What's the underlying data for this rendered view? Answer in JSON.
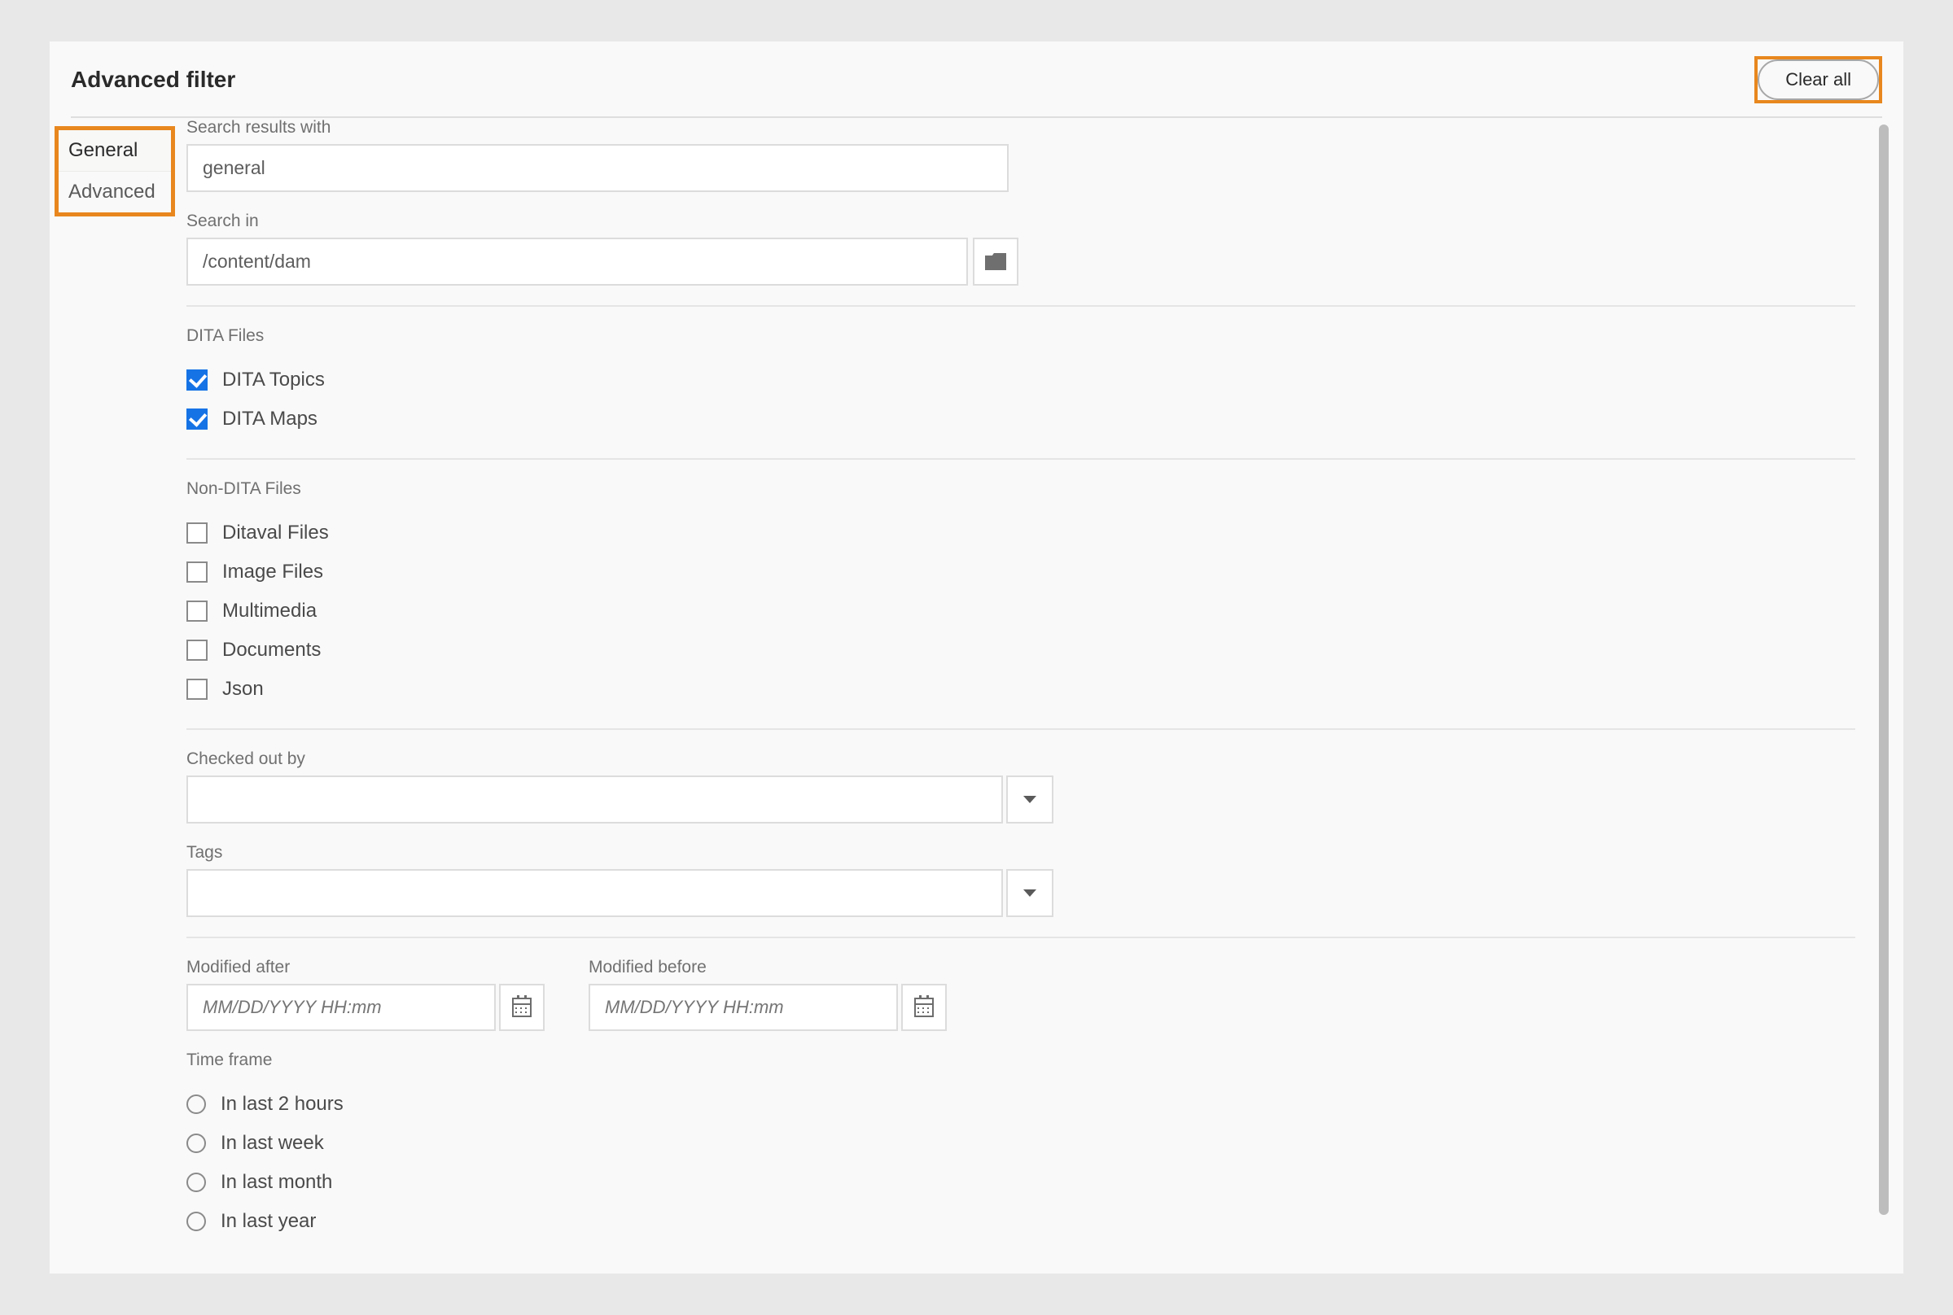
{
  "title": "Advanced filter",
  "clear_all": "Clear all",
  "tabs": {
    "general": "General",
    "advanced": "Advanced"
  },
  "search_results_with": {
    "label": "Search results with",
    "value": "general"
  },
  "search_in": {
    "label": "Search in",
    "value": "/content/dam"
  },
  "sections": {
    "dita_files": {
      "head": "DITA Files",
      "topics": {
        "label": "DITA Topics",
        "checked": true
      },
      "maps": {
        "label": "DITA Maps",
        "checked": true
      }
    },
    "non_dita_files": {
      "head": "Non-DITA Files",
      "ditaval": {
        "label": "Ditaval Files",
        "checked": false
      },
      "image": {
        "label": "Image Files",
        "checked": false
      },
      "multimedia": {
        "label": "Multimedia",
        "checked": false
      },
      "documents": {
        "label": "Documents",
        "checked": false
      },
      "json": {
        "label": "Json",
        "checked": false
      }
    },
    "checked_out_by": {
      "label": "Checked out by",
      "value": ""
    },
    "tags": {
      "label": "Tags",
      "value": ""
    },
    "modified_after": {
      "label": "Modified after",
      "placeholder": "MM/DD/YYYY HH:mm"
    },
    "modified_before": {
      "label": "Modified before",
      "placeholder": "MM/DD/YYYY HH:mm"
    },
    "timeframe": {
      "head": "Time frame",
      "h2": "In last 2 hours",
      "week": "In last week",
      "month": "In last month",
      "year": "In last year"
    }
  }
}
